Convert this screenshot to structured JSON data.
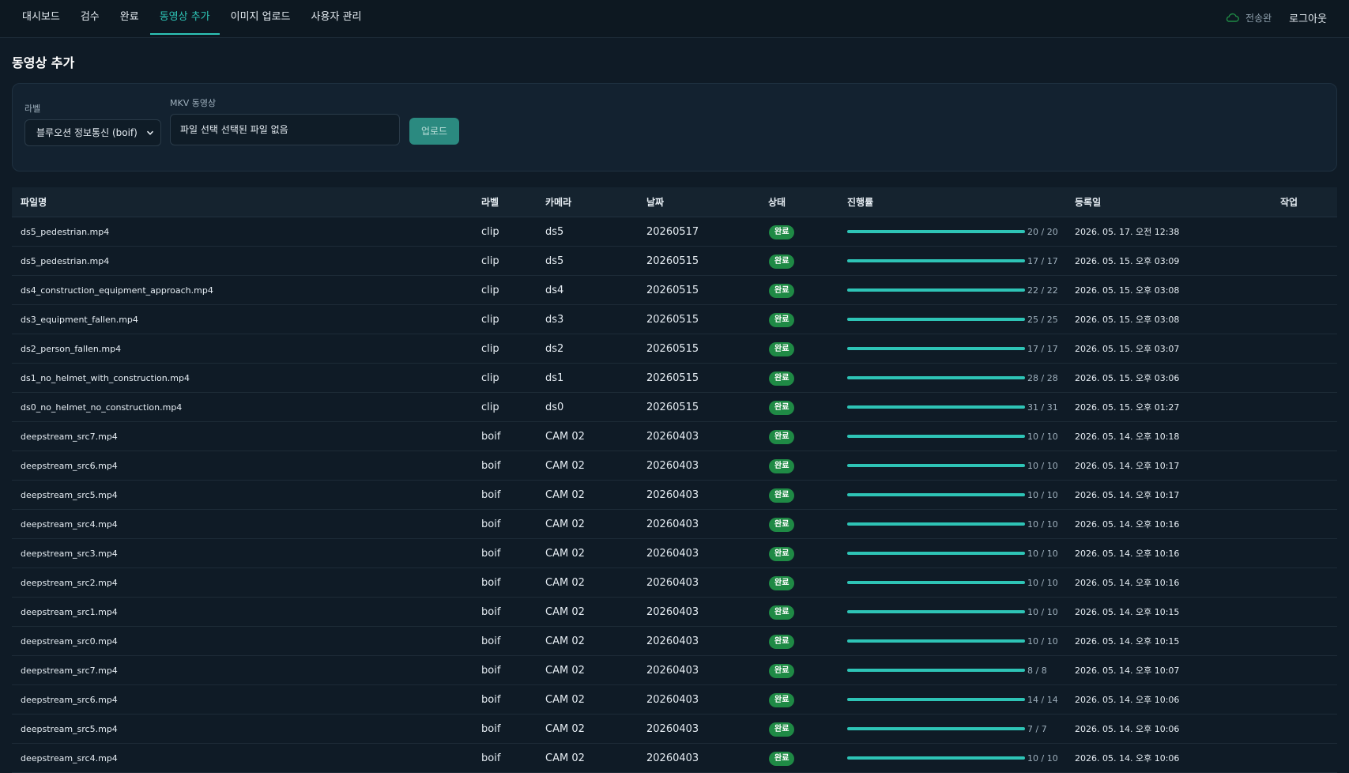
{
  "nav": {
    "items": [
      {
        "label": "대시보드",
        "active": false
      },
      {
        "label": "검수",
        "active": false
      },
      {
        "label": "완료",
        "active": false
      },
      {
        "label": "동영상 추가",
        "active": true
      },
      {
        "label": "이미지 업로드",
        "active": false
      },
      {
        "label": "사용자 관리",
        "active": false
      }
    ],
    "status_text": "전송완",
    "logout_label": "로그아웃",
    "status_icon": "cloud-icon"
  },
  "page": {
    "title": "동영상 추가"
  },
  "upload": {
    "label_caption": "라벨",
    "label_selected": "블루오션 정보통신 (boif)",
    "video_caption": "MKV 동영상",
    "file_text": "파일 선택  선택된 파일 없음",
    "upload_button": "업로드"
  },
  "table": {
    "headers": {
      "filename": "파일명",
      "label": "라벨",
      "camera": "카메라",
      "date": "날짜",
      "status": "상태",
      "progress": "진행률",
      "registered": "등록일",
      "action": "작업"
    },
    "rows": [
      {
        "filename": "ds5_pedestrian.mp4",
        "label": "clip",
        "camera": "ds5",
        "date": "20260517",
        "status": "완료",
        "progress_text": "20 / 20",
        "progress": 1.0,
        "registered": "2026. 05. 17. 오전 12:38"
      },
      {
        "filename": "ds5_pedestrian.mp4",
        "label": "clip",
        "camera": "ds5",
        "date": "20260515",
        "status": "완료",
        "progress_text": "17 / 17",
        "progress": 1.0,
        "registered": "2026. 05. 15. 오후 03:09"
      },
      {
        "filename": "ds4_construction_equipment_approach.mp4",
        "label": "clip",
        "camera": "ds4",
        "date": "20260515",
        "status": "완료",
        "progress_text": "22 / 22",
        "progress": 1.0,
        "registered": "2026. 05. 15. 오후 03:08"
      },
      {
        "filename": "ds3_equipment_fallen.mp4",
        "label": "clip",
        "camera": "ds3",
        "date": "20260515",
        "status": "완료",
        "progress_text": "25 / 25",
        "progress": 1.0,
        "registered": "2026. 05. 15. 오후 03:08"
      },
      {
        "filename": "ds2_person_fallen.mp4",
        "label": "clip",
        "camera": "ds2",
        "date": "20260515",
        "status": "완료",
        "progress_text": "17 / 17",
        "progress": 1.0,
        "registered": "2026. 05. 15. 오후 03:07"
      },
      {
        "filename": "ds1_no_helmet_with_construction.mp4",
        "label": "clip",
        "camera": "ds1",
        "date": "20260515",
        "status": "완료",
        "progress_text": "28 / 28",
        "progress": 1.0,
        "registered": "2026. 05. 15. 오후 03:06"
      },
      {
        "filename": "ds0_no_helmet_no_construction.mp4",
        "label": "clip",
        "camera": "ds0",
        "date": "20260515",
        "status": "완료",
        "progress_text": "31 / 31",
        "progress": 1.0,
        "registered": "2026. 05. 15. 오후 01:27"
      },
      {
        "filename": "deepstream_src7.mp4",
        "label": "boif",
        "camera": "CAM 02",
        "date": "20260403",
        "status": "완료",
        "progress_text": "10 / 10",
        "progress": 1.0,
        "registered": "2026. 05. 14. 오후 10:18"
      },
      {
        "filename": "deepstream_src6.mp4",
        "label": "boif",
        "camera": "CAM 02",
        "date": "20260403",
        "status": "완료",
        "progress_text": "10 / 10",
        "progress": 1.0,
        "registered": "2026. 05. 14. 오후 10:17"
      },
      {
        "filename": "deepstream_src5.mp4",
        "label": "boif",
        "camera": "CAM 02",
        "date": "20260403",
        "status": "완료",
        "progress_text": "10 / 10",
        "progress": 1.0,
        "registered": "2026. 05. 14. 오후 10:17"
      },
      {
        "filename": "deepstream_src4.mp4",
        "label": "boif",
        "camera": "CAM 02",
        "date": "20260403",
        "status": "완료",
        "progress_text": "10 / 10",
        "progress": 1.0,
        "registered": "2026. 05. 14. 오후 10:16"
      },
      {
        "filename": "deepstream_src3.mp4",
        "label": "boif",
        "camera": "CAM 02",
        "date": "20260403",
        "status": "완료",
        "progress_text": "10 / 10",
        "progress": 1.0,
        "registered": "2026. 05. 14. 오후 10:16"
      },
      {
        "filename": "deepstream_src2.mp4",
        "label": "boif",
        "camera": "CAM 02",
        "date": "20260403",
        "status": "완료",
        "progress_text": "10 / 10",
        "progress": 1.0,
        "registered": "2026. 05. 14. 오후 10:16"
      },
      {
        "filename": "deepstream_src1.mp4",
        "label": "boif",
        "camera": "CAM 02",
        "date": "20260403",
        "status": "완료",
        "progress_text": "10 / 10",
        "progress": 1.0,
        "registered": "2026. 05. 14. 오후 10:15"
      },
      {
        "filename": "deepstream_src0.mp4",
        "label": "boif",
        "camera": "CAM 02",
        "date": "20260403",
        "status": "완료",
        "progress_text": "10 / 10",
        "progress": 1.0,
        "registered": "2026. 05. 14. 오후 10:15"
      },
      {
        "filename": "deepstream_src7.mp4",
        "label": "boif",
        "camera": "CAM 02",
        "date": "20260403",
        "status": "완료",
        "progress_text": "8 / 8",
        "progress": 1.0,
        "registered": "2026. 05. 14. 오후 10:07"
      },
      {
        "filename": "deepstream_src6.mp4",
        "label": "boif",
        "camera": "CAM 02",
        "date": "20260403",
        "status": "완료",
        "progress_text": "14 / 14",
        "progress": 1.0,
        "registered": "2026. 05. 14. 오후 10:06"
      },
      {
        "filename": "deepstream_src5.mp4",
        "label": "boif",
        "camera": "CAM 02",
        "date": "20260403",
        "status": "완료",
        "progress_text": "7 / 7",
        "progress": 1.0,
        "registered": "2026. 05. 14. 오후 10:06"
      },
      {
        "filename": "deepstream_src4.mp4",
        "label": "boif",
        "camera": "CAM 02",
        "date": "20260403",
        "status": "완료",
        "progress_text": "10 / 10",
        "progress": 1.0,
        "registered": "2026. 05. 14. 오후 10:06"
      }
    ]
  },
  "colors": {
    "accent": "#2ec4b6",
    "badge": "#1f8a45",
    "background": "#0f1b26"
  }
}
